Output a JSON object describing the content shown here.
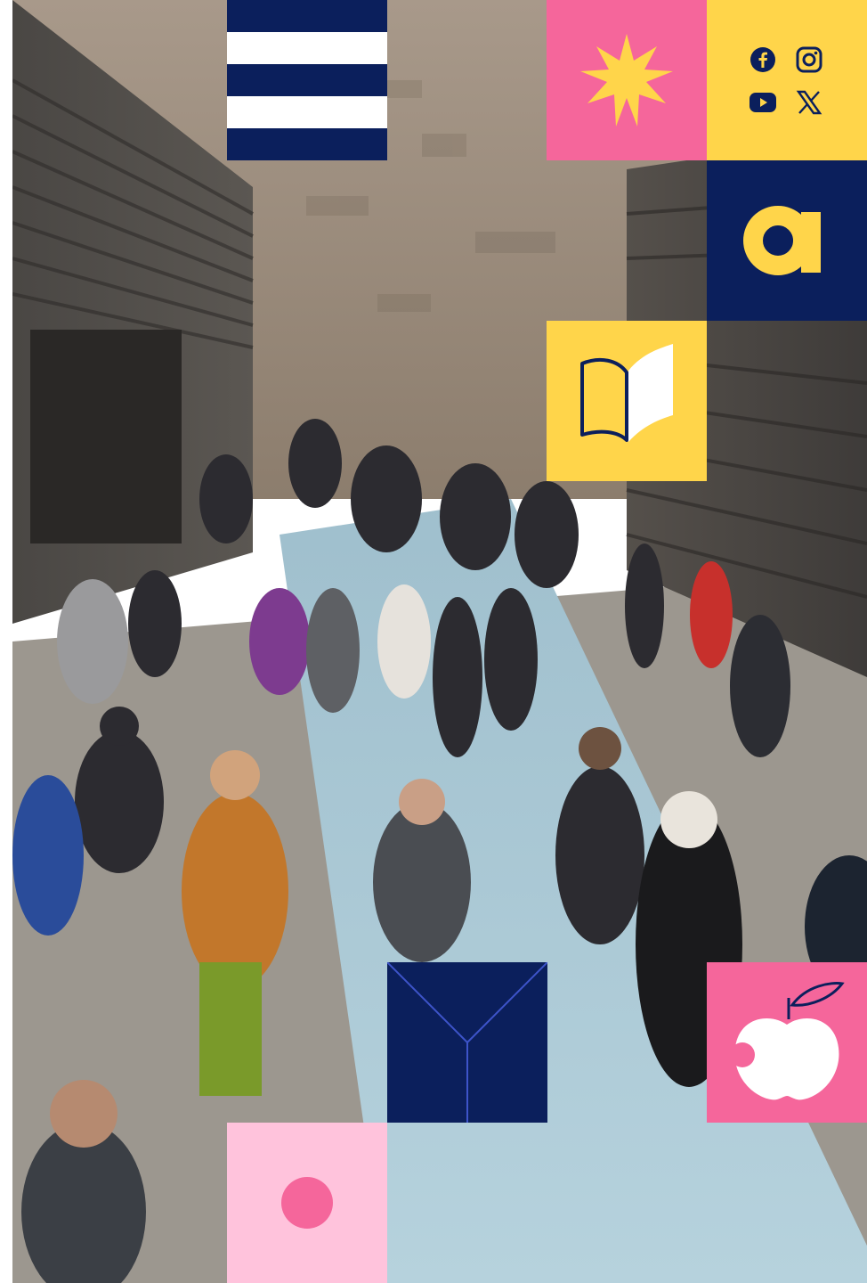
{
  "page": {
    "colors": {
      "navy": "#0b1f5c",
      "yellow": "#ffd54a",
      "pink": "#f5669b",
      "light_pink": "#ffc3dc",
      "white": "#ffffff",
      "sky_floor": "#a9c9d6"
    }
  },
  "hero_photo": {
    "description_icon": "crowd-photo"
  },
  "tiles": {
    "menu": {
      "icon": "hamburger-menu-icon"
    },
    "star": {
      "icon": "star-burst-icon"
    },
    "social": {
      "icons": [
        "facebook-icon",
        "instagram-icon",
        "youtube-icon",
        "x-icon"
      ]
    },
    "logo_letter": {
      "text": "a"
    },
    "book": {
      "icon": "open-book-icon"
    },
    "envelope": {
      "icon": "envelope-y-icon"
    },
    "apple": {
      "icon": "apple-icon"
    },
    "dot": {
      "icon": "dot-icon"
    }
  }
}
